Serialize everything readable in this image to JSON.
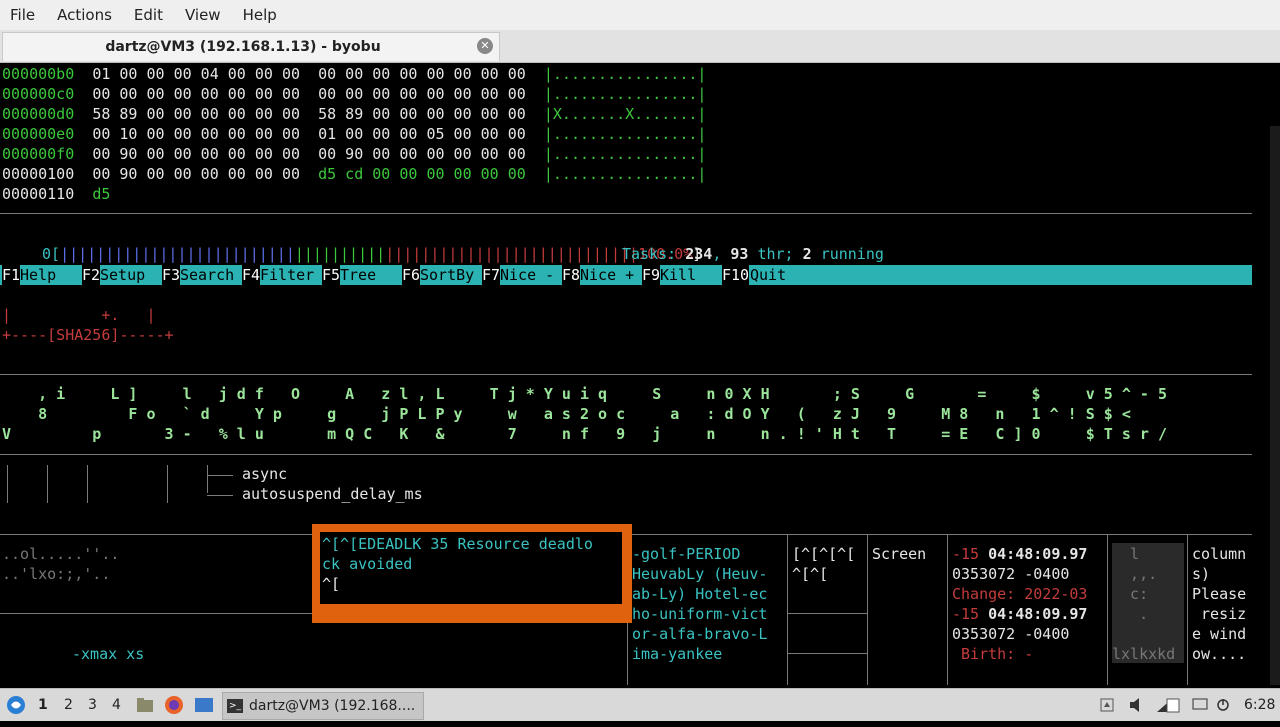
{
  "menu": [
    "File",
    "Actions",
    "Edit",
    "View",
    "Help"
  ],
  "tab": {
    "title": "dartz@VM3 (192.168.1.13) - byobu",
    "close_icon": "close-icon"
  },
  "hexdump": {
    "rows": [
      {
        "off": "000000b0",
        "b1": "01 00 00 00 04 00 00 00",
        "b2": "00 00 00 00 00 00 00 00",
        "asc": "|................|"
      },
      {
        "off": "000000c0",
        "b1": "00 00 00 00 00 00 00 00",
        "b2": "00 00 00 00 00 00 00 00",
        "asc": "|................|"
      },
      {
        "off": "000000d0",
        "b1": "58 89 00 00 00 00 00 00",
        "b2": "58 89 00 00 00 00 00 00",
        "asc": "|X.......X.......|"
      },
      {
        "off": "000000e0",
        "b1": "00 10 00 00 00 00 00 00",
        "b2": "01 00 00 00 05 00 00 00",
        "asc": "|................|"
      },
      {
        "off": "000000f0",
        "b1": "00 90 00 00 00 00 00 00",
        "b2": "00 90 00 00 00 00 00 00",
        "asc": "|................|"
      },
      {
        "off": "00000100",
        "b1": "00 90 00 00 00 00 00 00",
        "b2": "d5 cd 00 00 00 00 00 00",
        "asc": "|................|"
      },
      {
        "off": "00000110",
        "b1": "d5",
        "b2": "",
        "asc": ""
      }
    ]
  },
  "htop": {
    "cpu_label": "0[",
    "cpu_blue": "||||||||||||||||||||||||||",
    "cpu_green": "||||||||||",
    "cpu_red": "||||||||||||||||||||||||||||",
    "cpu_pct": "100.0%",
    "cpu_close": "]",
    "tasks_label": "Tasks:",
    "tasks_n": "234",
    "sep1": ",",
    "thr_n": "93",
    "thr_label": "thr;",
    "run_n": "2",
    "run_label": "running",
    "fkeys": [
      {
        "k": "F1",
        "l": "Help  "
      },
      {
        "k": "F2",
        "l": "Setup "
      },
      {
        "k": "F3",
        "l": "Search"
      },
      {
        "k": "F4",
        "l": "Filter"
      },
      {
        "k": "F5",
        "l": "Tree  "
      },
      {
        "k": "F6",
        "l": "SortBy"
      },
      {
        "k": "F7",
        "l": "Nice -"
      },
      {
        "k": "F8",
        "l": "Nice +"
      },
      {
        "k": "F9",
        "l": "Kill  "
      },
      {
        "k": "F10",
        "l": "Quit"
      }
    ]
  },
  "sha": {
    "line1": "|          +.   |",
    "line2": "+----[SHA256]-----+"
  },
  "matrix": {
    "row1": "    , i     L ]     l   j d f   O     A   z l , L     T j * Y u i q     S     n 0 X H       ; S     G       =     $     v 5 ^ - 5",
    "row2": "    8         F o   ` d     Y p     g     j P L P y     w   a s 2 o c     a   : d O Y   (   z J   9     M 8   n   1 ^ ! S $ <",
    "row3": "V         p       3 -   % l u       m Q C   K   &       7     n f   9   j     n     n . ! ' H t   T     = E   C ] 0     $ T s r /"
  },
  "tree": {
    "item1": "async",
    "item2": "autosuspend_delay_ms"
  },
  "bottom": {
    "p1a": "..ol.....''..",
    "p1b": "..'lxo:;,'..",
    "xmax": "-xmax xs",
    "popup_l1": "^[^[EDEADLK 35 Resource deadlo",
    "popup_l2": "ck avoided",
    "popup_l3": "^[",
    "nato": [
      "-golf-PERIOD",
      "HeuvabLy (Heuv-",
      "ab-Ly) Hotel-ec",
      "ho-uniform-vict",
      "or-alfa-bravo-L",
      "ima-yankee"
    ],
    "esc1": "[^[^[^[",
    "esc2": "^[^[",
    "screen": "Screen",
    "stat": [
      {
        "a": "-15 ",
        "b": "04:48:09.97"
      },
      {
        "a": "0353072 -0400",
        "b": ""
      },
      {
        "a": "Change: 2022-03",
        "b": ""
      },
      {
        "a": "-15 ",
        "b": "04:48:09.97"
      },
      {
        "a": "0353072 -0400",
        "b": ""
      },
      {
        "a": " Birth: -",
        "b": ""
      }
    ],
    "art": [
      "  l  ",
      "  ,,.",
      "  c: ",
      "   . ",
      "     ",
      "lxlkxkd"
    ],
    "resize": [
      "column",
      "s)",
      "Please",
      " resiz",
      "e wind",
      "ow...."
    ]
  },
  "taskbar": {
    "workspaces": [
      "1",
      "2",
      "3",
      "4"
    ],
    "task_label": "dartz@VM3 (192.168....",
    "clock": "6:28"
  },
  "colors": {
    "popup": "#e0620f",
    "fbar": "#2bb3b3",
    "hex_green": "#3cc83c"
  }
}
